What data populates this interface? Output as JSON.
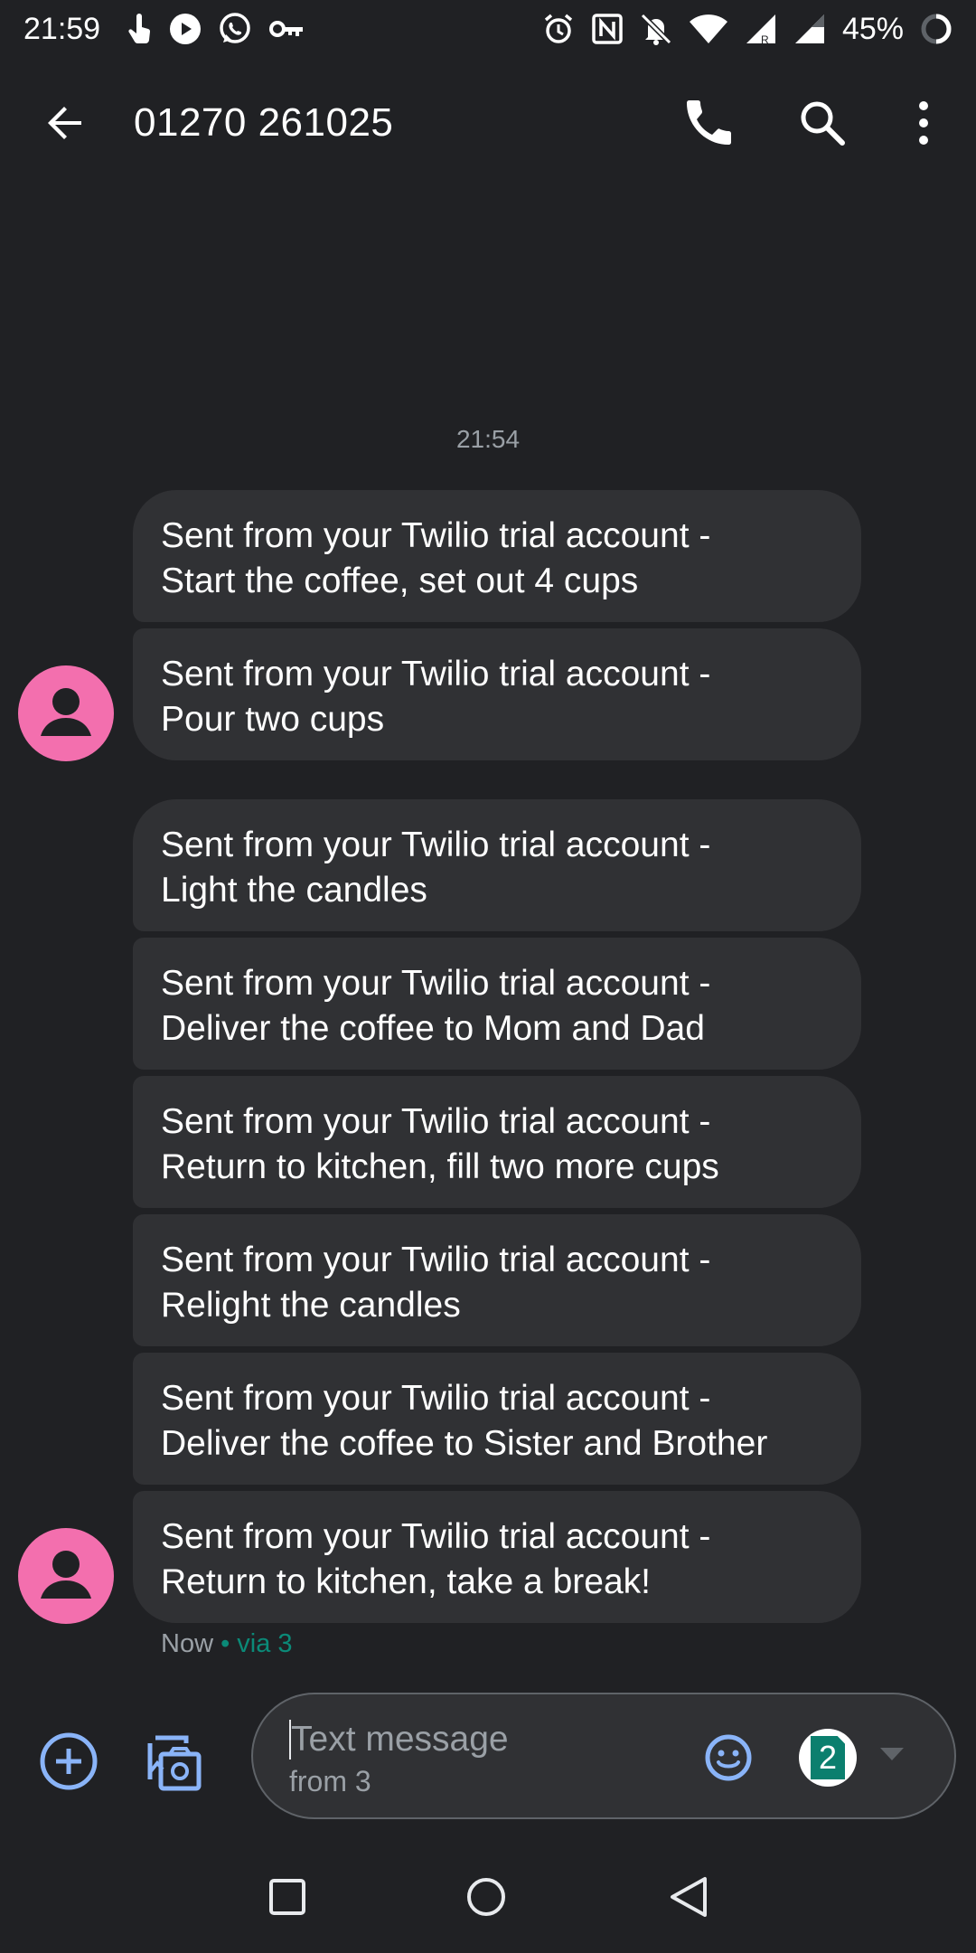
{
  "status_bar": {
    "time": "21:59",
    "battery_percent": "45%",
    "icons": [
      "touch-icon",
      "youtube-icon",
      "whatsapp-icon",
      "vpn-key-icon",
      "alarm-icon",
      "nfc-icon",
      "bell-off-icon",
      "wifi-icon",
      "signal-roaming-icon",
      "signal-icon",
      "battery-icon"
    ]
  },
  "app_bar": {
    "title": "01270 261025",
    "icons": [
      "back-arrow-icon",
      "phone-icon",
      "search-icon",
      "more-vert-icon"
    ]
  },
  "conversation": {
    "timestamp": "21:54",
    "messages": [
      {
        "text": "Sent from your Twilio trial account -\nStart the coffee, set out 4 cups"
      },
      {
        "text": "Sent from your Twilio trial account -\nPour two cups"
      },
      {
        "text": "Sent from your Twilio trial account -\nLight the candles"
      },
      {
        "text": "Sent from your Twilio trial account -\nDeliver the coffee to Mom and Dad"
      },
      {
        "text": "Sent from your Twilio trial account -\nReturn to kitchen, fill two more cups"
      },
      {
        "text": "Sent from your Twilio trial account -\nRelight the candles"
      },
      {
        "text": "Sent from your Twilio trial account -\nDeliver the coffee to Sister and Brother"
      },
      {
        "text": "Sent from your Twilio trial account -\nReturn to kitchen, take a break!"
      }
    ],
    "last_meta": {
      "time": "Now",
      "separator": " • ",
      "via": "via 3"
    }
  },
  "compose": {
    "placeholder": "Text message",
    "sub": "from 3",
    "sim_number": "2"
  },
  "colors": {
    "background": "#202124",
    "bubble": "#303134",
    "avatar": "#f36fae",
    "accent_blue": "#8ab4f8",
    "sim_green": "#0b7f6e"
  }
}
